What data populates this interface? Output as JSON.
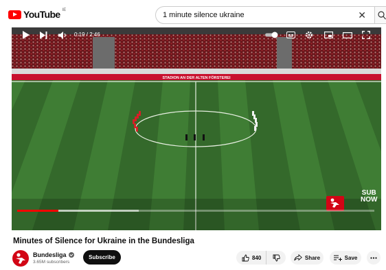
{
  "header": {
    "logo_text": "YouTube",
    "region_code": "IE",
    "search_query": "1 minute silence ukraine"
  },
  "player": {
    "current_time": "0:19 / 2:46",
    "progress": 0.115,
    "buffered": 0.34,
    "overlay_text_line1": "SUB",
    "overlay_text_line2": "NOW",
    "banner_text": "STADION AN DER ALTEN FÖRSTEREI",
    "colors": {
      "progress": "#ff0000",
      "pitch_light": "#3f7d34",
      "pitch_dark": "#34692b",
      "banner": "#c8102e"
    }
  },
  "video": {
    "title": "Minutes of Silence for Ukraine in the Bundesliga",
    "channel_name": "Bundesliga",
    "subscribers": "3.65M subscribers",
    "subscribe_label": "Subscribe",
    "like_count": "840",
    "share_label": "Share",
    "save_label": "Save"
  }
}
